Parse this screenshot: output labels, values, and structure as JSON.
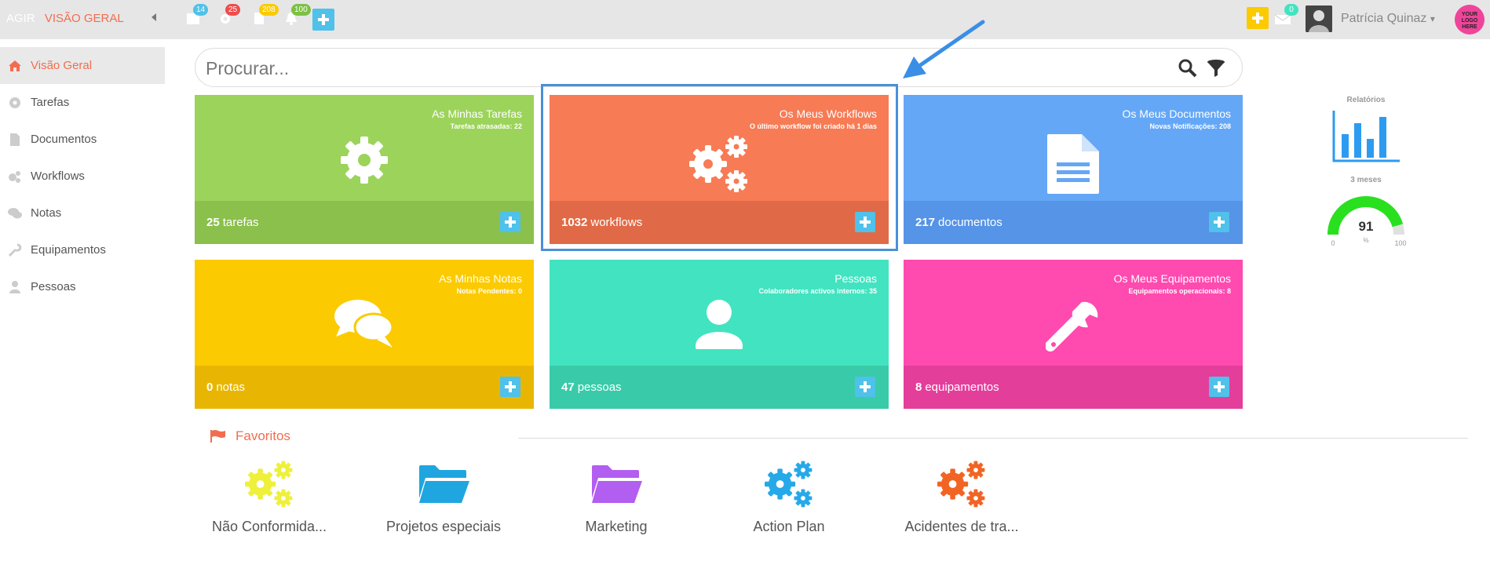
{
  "topbar": {
    "brand_left": "AGIR",
    "brand_right": "VISÃO GERAL",
    "badges": {
      "calendar": "14",
      "settings": "25",
      "documents": "208",
      "notifications": "100",
      "messages": "0"
    },
    "user_name": "Patrícia Quinaz",
    "logo_text": "YOUR LOGO HERE"
  },
  "sidebar": {
    "items": [
      {
        "label": "Visão Geral",
        "icon": "home-icon"
      },
      {
        "label": "Tarefas",
        "icon": "gear-icon"
      },
      {
        "label": "Documentos",
        "icon": "document-icon"
      },
      {
        "label": "Workflows",
        "icon": "gears-icon"
      },
      {
        "label": "Notas",
        "icon": "chat-icon"
      },
      {
        "label": "Equipamentos",
        "icon": "wrench-icon"
      },
      {
        "label": "Pessoas",
        "icon": "person-icon"
      }
    ]
  },
  "search": {
    "placeholder": "Procurar..."
  },
  "tiles": [
    {
      "title": "As Minhas Tarefas",
      "subtitle": "Tarefas atrasadas: 22",
      "count": "25",
      "unit": "tarefas",
      "color": "#9cd35a",
      "footer_color": "#8ac04b"
    },
    {
      "title": "Os Meus Workflows",
      "subtitle": "O último workflow foi criado há 1 dias",
      "count": "1032",
      "unit": "workflows",
      "color": "#f77b55",
      "footer_color": "#e06a47"
    },
    {
      "title": "Os Meus Documentos",
      "subtitle": "Novas Notificações: 208",
      "count": "217",
      "unit": "documentos",
      "color": "#64a7f7",
      "footer_color": "#5594e6"
    },
    {
      "title": "As Minhas Notas",
      "subtitle": "Notas Pendentes: 0",
      "count": "0",
      "unit": "notas",
      "color": "#fcca01",
      "footer_color": "#e8b602"
    },
    {
      "title": "Pessoas",
      "subtitle": "Colaboradores activos internos: 35",
      "count": "47",
      "unit": "pessoas",
      "color": "#42e3c0",
      "footer_color": "#39cba9"
    },
    {
      "title": "Os Meus Equipamentos",
      "subtitle": "Equipamentos operacionais: 8",
      "count": "8",
      "unit": "equipamentos",
      "color": "#ff4aaf",
      "footer_color": "#e43e9b"
    }
  ],
  "favorites": {
    "title": "Favoritos",
    "items": [
      {
        "label": "Não Conformida...",
        "icon": "gears-icon",
        "color": "#eef03a"
      },
      {
        "label": "Projetos especiais",
        "icon": "folder-icon",
        "color": "#1fa6e0"
      },
      {
        "label": "Marketing",
        "icon": "folder-icon",
        "color": "#b25ef0"
      },
      {
        "label": "Action Plan",
        "icon": "gears-icon",
        "color": "#26a9e8"
      },
      {
        "label": "Acidentes de tra...",
        "icon": "gears-icon",
        "color": "#f26424"
      }
    ]
  },
  "widgets": {
    "reports_label": "Relatórios",
    "period_label": "3 meses",
    "gauge": {
      "value": "91",
      "min": "0",
      "max": "100",
      "unit": "%",
      "fraction": 0.91
    }
  }
}
